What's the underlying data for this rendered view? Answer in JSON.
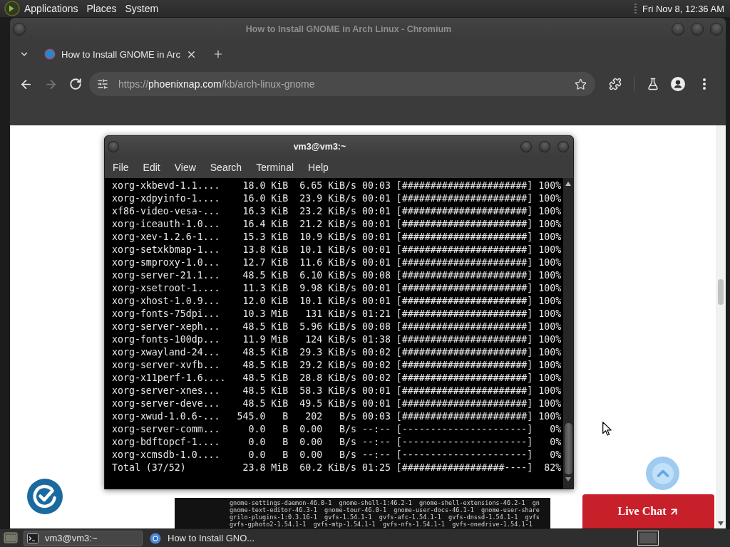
{
  "top_panel": {
    "menus": [
      "Applications",
      "Places",
      "System"
    ],
    "clock": "Fri Nov 8, 12:36 AM"
  },
  "browser": {
    "window_title": "How to Install GNOME in Arch Linux - Chromium",
    "tabs": [
      {
        "title": "How to Install GNOME in Arc"
      }
    ],
    "forward_disabled": true,
    "url": {
      "scheme": "https://",
      "host": "phoenixnap.com",
      "path": "/kb/arch-linux-gnome"
    }
  },
  "page": {
    "terminal_screenshot": {
      "title": "vm3@vm3:~",
      "menu": [
        "File",
        "Edit",
        "View",
        "Search",
        "Terminal",
        "Help"
      ],
      "lines": [
        "xorg-xkbevd-1.1....    18.0 KiB  6.65 KiB/s 00:03 [######################] 100%",
        "xorg-xdpyinfo-1....    16.0 KiB  23.9 KiB/s 00:01 [######################] 100%",
        "xf86-video-vesa-...    16.3 KiB  23.2 KiB/s 00:01 [######################] 100%",
        "xorg-iceauth-1.0...    16.4 KiB  21.2 KiB/s 00:01 [######################] 100%",
        "xorg-xev-1.2.6-1...    15.3 KiB  10.9 KiB/s 00:01 [######################] 100%",
        "xorg-setxkbmap-1...    13.8 KiB  10.1 KiB/s 00:01 [######################] 100%",
        "xorg-smproxy-1.0...    12.7 KiB  11.6 KiB/s 00:01 [######################] 100%",
        "xorg-server-21.1...    48.5 KiB  6.10 KiB/s 00:08 [######################] 100%",
        "xorg-xsetroot-1....    11.3 KiB  9.98 KiB/s 00:01 [######################] 100%",
        "xorg-xhost-1.0.9...    12.0 KiB  10.1 KiB/s 00:01 [######################] 100%",
        "xorg-fonts-75dpi...    10.3 MiB   131 KiB/s 01:21 [######################] 100%",
        "xorg-server-xeph...    48.5 KiB  5.96 KiB/s 00:08 [######################] 100%",
        "xorg-fonts-100dp...    11.9 MiB   124 KiB/s 01:38 [######################] 100%",
        "xorg-xwayland-24...    48.5 KiB  29.3 KiB/s 00:02 [######################] 100%",
        "xorg-server-xvfb...    48.5 KiB  29.2 KiB/s 00:02 [######################] 100%",
        "xorg-x11perf-1.6....   48.5 KiB  28.8 KiB/s 00:02 [######################] 100%",
        "xorg-server-xnes...    48.5 KiB  58.3 KiB/s 00:01 [######################] 100%",
        "xorg-server-deve...    48.5 KiB  49.5 KiB/s 00:01 [######################] 100%",
        "xorg-xwud-1.0.6-...   545.0   B   202   B/s 00:03 [######################] 100%",
        "xorg-server-comm...     0.0   B  0.00   B/s --:-- [----------------------]   0%",
        "xorg-bdftopcf-1....     0.0   B  0.00   B/s --:-- [----------------------]   0%",
        "xorg-xcmsdb-1.0....     0.0   B  0.00   B/s --:-- [----------------------]   0%",
        "Total (37/52)          23.8 MiB  60.2 KiB/s 01:25 [##################----]  82%"
      ]
    },
    "output_screenshot": {
      "lines": [
        "gnome-settings-daemon-46.0-1  gnome-shell-1:46.2-1  gnome-shell-extensions-46.2-1  gn",
        "gnome-text-editor-46.3-1  gnome-tour-46.0-1  gnome-user-docs-46.1-1  gnome-user-share",
        "grilo-plugins-1:0.3.16-1  gvfs-1.54.1-1  gvfs-afc-1.54.1-1  gvfs-dnssd-1.54.1-1  gvfs",
        "gvfs-gphoto2-1.54.1-1  gvfs-mtp-1.54.1-1  gvfs-nfs-1.54.1-1  gvfs-onedrive-1.54.1-1"
      ]
    },
    "live_chat": "Live Chat"
  },
  "taskbar": {
    "tasks": [
      {
        "kind": "terminal",
        "label": "vm3@vm3:~",
        "selected": true
      },
      {
        "kind": "browser",
        "label": "How to Install GNO...",
        "selected": false
      }
    ]
  }
}
